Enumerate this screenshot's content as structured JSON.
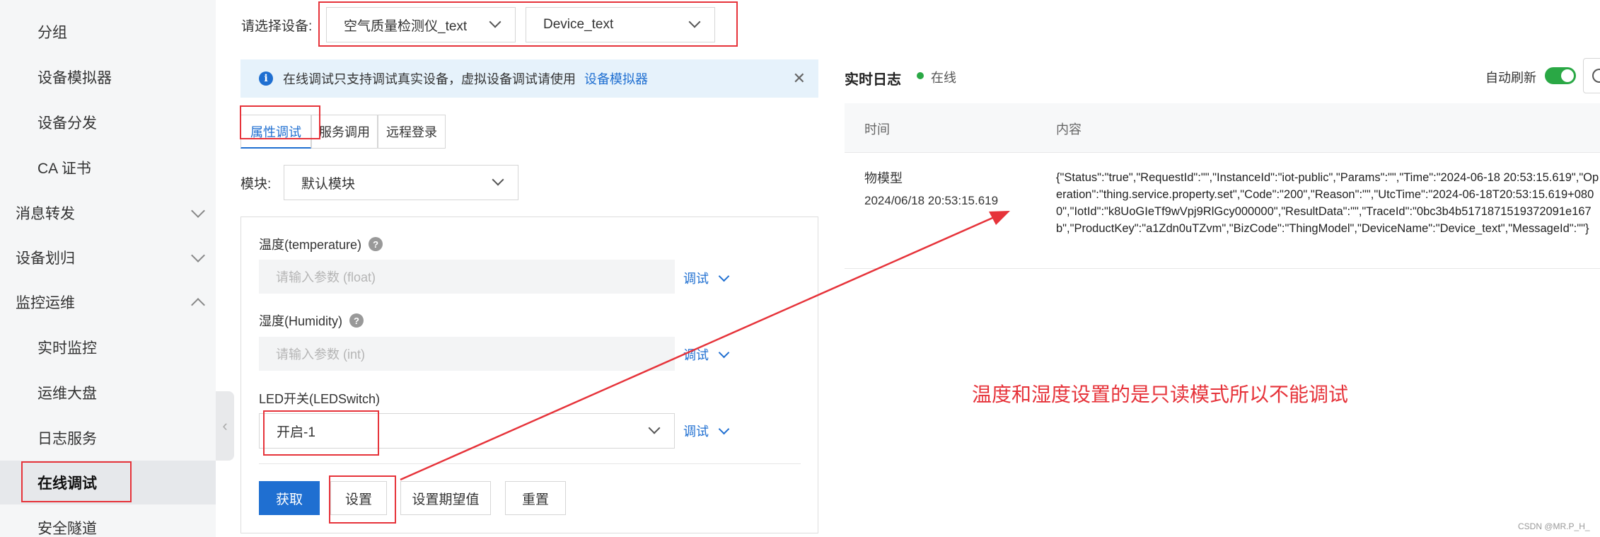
{
  "sidebar": {
    "items": [
      {
        "label": "分组"
      },
      {
        "label": "设备模拟器"
      },
      {
        "label": "设备分发"
      },
      {
        "label": "CA 证书"
      },
      {
        "label": "消息转发"
      },
      {
        "label": "设备划归"
      },
      {
        "label": "监控运维"
      },
      {
        "label": "实时监控"
      },
      {
        "label": "运维大盘"
      },
      {
        "label": "日志服务"
      },
      {
        "label": "在线调试"
      },
      {
        "label": "安全隧道"
      }
    ]
  },
  "device_select": {
    "label": "请选择设备:",
    "product": "空气质量检测仪_text",
    "device": "Device_text"
  },
  "banner": {
    "text": "在线调试只支持调试真实设备，虚拟设备调试请使用",
    "link": "设备模拟器"
  },
  "tabs": [
    {
      "label": "属性调试"
    },
    {
      "label": "服务调用"
    },
    {
      "label": "远程登录"
    }
  ],
  "module": {
    "label": "模块:",
    "value": "默认模块"
  },
  "properties": [
    {
      "label": "温度(temperature)",
      "placeholder": "请输入参数 (float)",
      "debug": "调试"
    },
    {
      "label": "湿度(Humidity)",
      "placeholder": "请输入参数 (int)",
      "debug": "调试"
    },
    {
      "label": "LED开关(LEDSwitch)",
      "value": "开启-1",
      "debug": "调试"
    }
  ],
  "actions": {
    "get": "获取",
    "set": "设置",
    "set_expected": "设置期望值",
    "reset": "重置"
  },
  "log": {
    "title": "实时日志",
    "status": "在线",
    "auto_refresh": "自动刷新",
    "col_time": "时间",
    "col_content": "内容",
    "rows": [
      {
        "type": "物模型",
        "time": "2024/06/18 20:53:15.619",
        "content": "{\"Status\":\"true\",\"RequestId\":\"\",\"InstanceId\":\"iot-public\",\"Params\":\"\",\"Time\":\"2024-06-18 20:53:15.619\",\"Operation\":\"thing.service.property.set\",\"Code\":\"200\",\"Reason\":\"\",\"UtcTime\":\"2024-06-18T20:53:15.619+0800\",\"IotId\":\"k8UoGIeTf9wVpj9RlGcy000000\",\"ResultData\":\"\",\"TraceId\":\"0bc3b4b5171871519372091e167b\",\"ProductKey\":\"a1Zdn0uTZvm\",\"BizCode\":\"ThingModel\",\"DeviceName\":\"Device_text\",\"MessageId\":\"\"}"
      }
    ]
  },
  "annotation": "温度和湿度设置的是只读模式所以不能调试",
  "watermark": "CSDN @MR.P_H_",
  "colors": {
    "accent": "#1f6fd1",
    "online": "#2aa845",
    "highlight": "#e6333a"
  }
}
